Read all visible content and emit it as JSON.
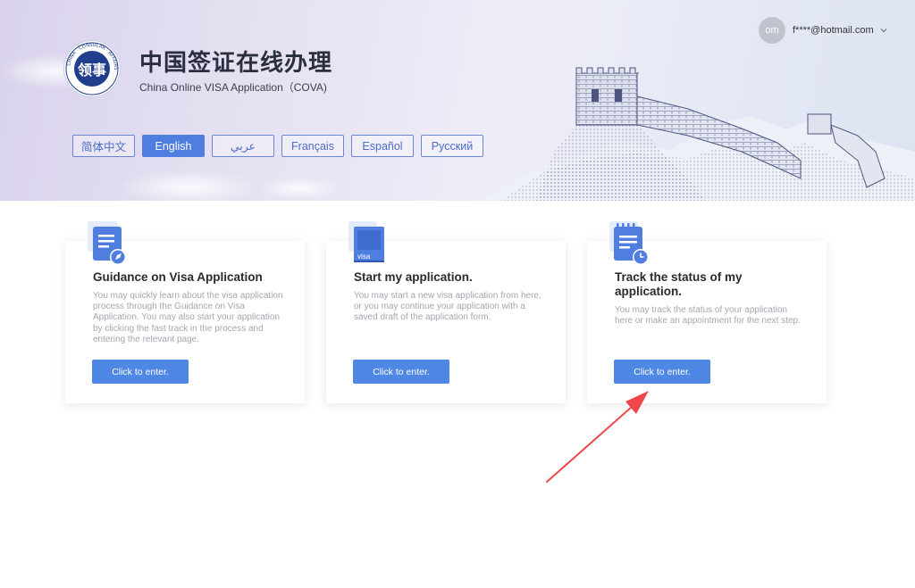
{
  "header": {
    "title_cn": "中国签证在线办理",
    "title_en": "China Online VISA Application（COVA)",
    "logo": {
      "ring_text": "CHINA · CONSULAR · AFFAIRS",
      "center_text": "领事"
    }
  },
  "languages": [
    {
      "label": "简体中文",
      "active": false
    },
    {
      "label": "English",
      "active": true
    },
    {
      "label": "عربي",
      "active": false
    },
    {
      "label": "Français",
      "active": false
    },
    {
      "label": "Español",
      "active": false
    },
    {
      "label": "Русский",
      "active": false
    }
  ],
  "user": {
    "avatar_initials": "om",
    "email": "f****@hotmail.com"
  },
  "cards": [
    {
      "icon": "document-compass-icon",
      "title": "Guidance on Visa Application",
      "description": "You may quickly learn about the visa application process through the Guidance on Visa Application. You may also start your application by clicking the fast track in the process and entering the relevant page.",
      "button": "Click to enter."
    },
    {
      "icon": "visa-book-icon",
      "icon_text": "visa",
      "title": "Start my application.",
      "description": "You may start a new visa application from here, or you may continue your application with a saved draft of the application form.",
      "button": "Click to enter."
    },
    {
      "icon": "notepad-clock-icon",
      "title": "Track the status of my application.",
      "description": "You may track the status of your application here or make an appointment for the next step.",
      "button": "Click to enter."
    }
  ],
  "colors": {
    "accent": "#4f87e5",
    "lang_border": "#6a87d6",
    "annotation_arrow": "#f0474a"
  }
}
